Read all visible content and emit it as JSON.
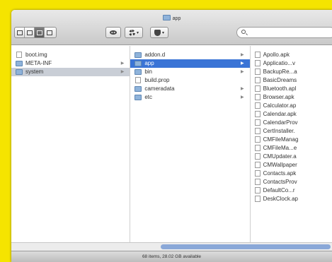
{
  "window": {
    "title": "app"
  },
  "toolbar": {
    "view_buttons": [
      "icon-view",
      "list-view",
      "column-view",
      "coverflow-view"
    ],
    "active_view": "column-view",
    "search_placeholder": ""
  },
  "columns": {
    "col1": [
      {
        "name": "boot.img",
        "kind": "file"
      },
      {
        "name": "META-INF",
        "kind": "folder"
      },
      {
        "name": "system",
        "kind": "folder",
        "selected": "gray"
      }
    ],
    "col2": [
      {
        "name": "addon.d",
        "kind": "folder"
      },
      {
        "name": "app",
        "kind": "folder",
        "selected": "blue"
      },
      {
        "name": "bin",
        "kind": "folder"
      },
      {
        "name": "build.prop",
        "kind": "file"
      },
      {
        "name": "cameradata",
        "kind": "folder"
      },
      {
        "name": "etc",
        "kind": "folder"
      }
    ],
    "col3": [
      "Apollo.apk",
      "Applicatio...v",
      "BackupRe...a",
      "BasicDreams",
      "Bluetooth.apl",
      "Browser.apk",
      "Calculator.ap",
      "Calendar.apk",
      "CalendarProv",
      "CertInstaller.",
      "CMFileManag",
      "CMFileMa...e",
      "CMUpdater.a",
      "CMWallpaper",
      "Contacts.apk",
      "ContactsProv",
      "DefaultCo...r",
      "DeskClock.ap"
    ]
  },
  "statusbar": {
    "text": "68 items, 28.02 GB available"
  },
  "colors": {
    "background": "#f5e400",
    "selection": "#3a74d6",
    "folder": "#8fb3da"
  }
}
